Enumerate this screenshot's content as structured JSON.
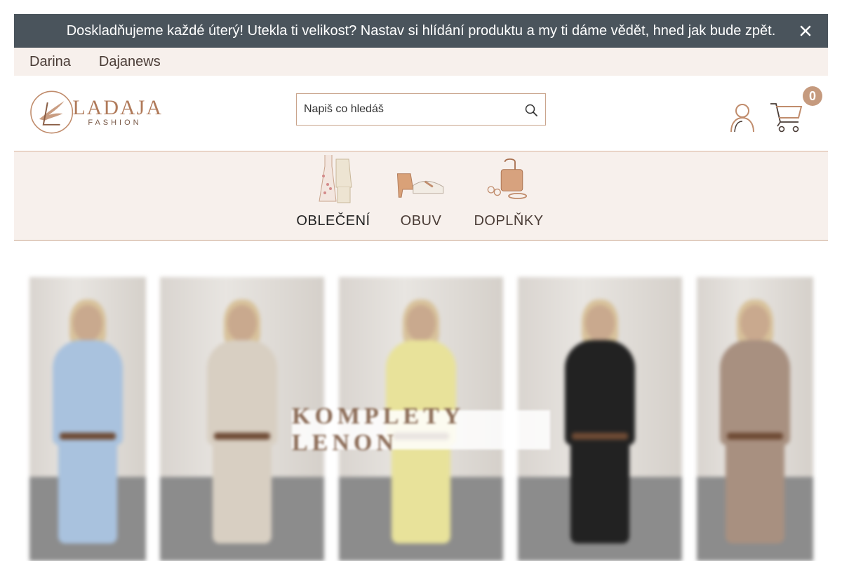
{
  "announcement": {
    "text": "Doskladňujeme každé úterý! Utekla ti velikost? Nastav si hlídání produktu a my ti dáme vědět, hned jak bude zpět.",
    "close_icon": "close-icon"
  },
  "top_links": [
    {
      "label": "Darina"
    },
    {
      "label": "Dajanews"
    }
  ],
  "header": {
    "logo_title": "LADAJA",
    "logo_subtitle": "FASHION",
    "search_placeholder": "Napiš co hledáš",
    "search_icon": "search-icon",
    "user_icon": "user-icon",
    "cart_icon": "cart-icon",
    "cart_count": "0"
  },
  "categories": [
    {
      "label": "OBLEČENÍ",
      "active": true,
      "icon": "clothing-icon"
    },
    {
      "label": "OBUV",
      "active": false,
      "icon": "shoes-icon"
    },
    {
      "label": "DOPLŇKY",
      "active": false,
      "icon": "accessories-icon"
    }
  ],
  "hero": {
    "overlay_text": "KOMPLETY LENON",
    "outfits": [
      {
        "color": "#a9c2de"
      },
      {
        "color": "#d8cfc2"
      },
      {
        "color": "#e8e29a"
      },
      {
        "color": "#222222"
      },
      {
        "color": "#a89080"
      }
    ]
  },
  "colors": {
    "accent": "#c59a7e",
    "announcement_bg": "#4a545c",
    "nav_bg": "#f7f0ec"
  }
}
